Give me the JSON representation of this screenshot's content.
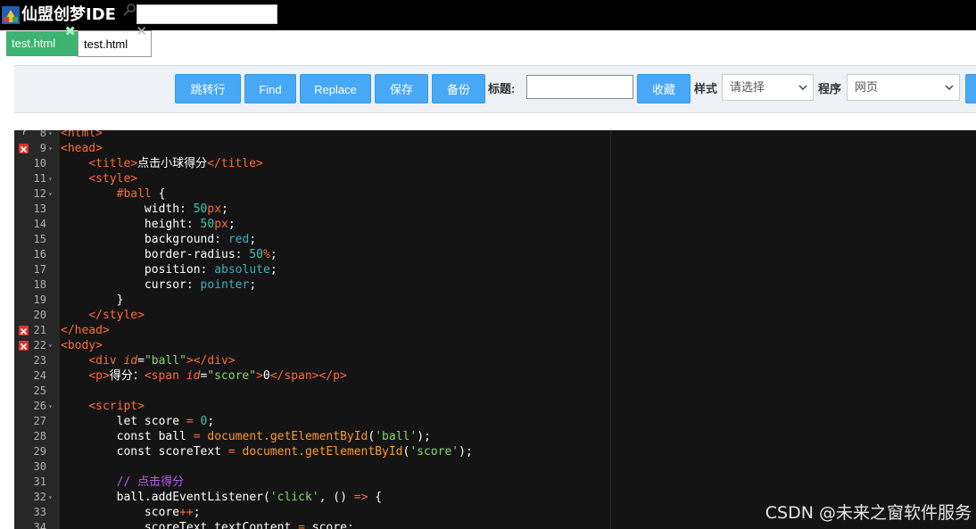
{
  "app": {
    "title": "仙盟创梦IDE",
    "search_value": ""
  },
  "tabs": [
    {
      "label": "test.html",
      "active": true,
      "close": "✖"
    },
    {
      "label": "test.html",
      "active": false,
      "close": "✕"
    }
  ],
  "toolbar": {
    "goto_label": "跳转行",
    "find_label": "Find",
    "replace_label": "Replace",
    "save_label": "保存",
    "backup_label": "备份",
    "title_label": "标题:",
    "title_value": "",
    "favorite_label": "收藏",
    "style_label": "样式",
    "style_selected": "请选择",
    "program_label": "程序",
    "program_selected": "网页"
  },
  "editor": {
    "lines": [
      {
        "n": "8",
        "marker": "warn",
        "fold": true,
        "tokens": [
          [
            "t-tag",
            "<html>"
          ]
        ]
      },
      {
        "n": "9",
        "marker": "error",
        "fold": true,
        "tokens": [
          [
            "t-tag",
            "<head>"
          ]
        ]
      },
      {
        "n": "10",
        "tokens": [
          [
            "t-plain",
            "    "
          ],
          [
            "t-tag",
            "<title>"
          ],
          [
            "t-plain",
            "点击小球得分"
          ],
          [
            "t-tag",
            "</title>"
          ]
        ]
      },
      {
        "n": "11",
        "fold": true,
        "tokens": [
          [
            "t-plain",
            "    "
          ],
          [
            "t-tag",
            "<style>"
          ]
        ]
      },
      {
        "n": "12",
        "fold": true,
        "tokens": [
          [
            "t-plain",
            "        "
          ],
          [
            "t-tag",
            "#ball"
          ],
          [
            "t-plain",
            " {"
          ]
        ]
      },
      {
        "n": "13",
        "tokens": [
          [
            "t-plain",
            "            width: "
          ],
          [
            "t-num",
            "50"
          ],
          [
            "t-unit",
            "px"
          ],
          [
            "t-plain",
            ";"
          ]
        ]
      },
      {
        "n": "14",
        "tokens": [
          [
            "t-plain",
            "            height: "
          ],
          [
            "t-num",
            "50"
          ],
          [
            "t-unit",
            "px"
          ],
          [
            "t-plain",
            ";"
          ]
        ]
      },
      {
        "n": "15",
        "tokens": [
          [
            "t-plain",
            "            background: "
          ],
          [
            "t-val",
            "red"
          ],
          [
            "t-plain",
            ";"
          ]
        ]
      },
      {
        "n": "16",
        "tokens": [
          [
            "t-plain",
            "            border-radius: "
          ],
          [
            "t-num",
            "50"
          ],
          [
            "t-unit",
            "%"
          ],
          [
            "t-plain",
            ";"
          ]
        ]
      },
      {
        "n": "17",
        "tokens": [
          [
            "t-plain",
            "            position: "
          ],
          [
            "t-val",
            "absolute"
          ],
          [
            "t-plain",
            ";"
          ]
        ]
      },
      {
        "n": "18",
        "tokens": [
          [
            "t-plain",
            "            cursor: "
          ],
          [
            "t-val",
            "pointer"
          ],
          [
            "t-plain",
            ";"
          ]
        ]
      },
      {
        "n": "19",
        "tokens": [
          [
            "t-plain",
            "        }"
          ]
        ]
      },
      {
        "n": "20",
        "tokens": [
          [
            "t-plain",
            "    "
          ],
          [
            "t-tag",
            "</style>"
          ]
        ]
      },
      {
        "n": "21",
        "marker": "error",
        "tokens": [
          [
            "t-tag",
            "</head>"
          ]
        ]
      },
      {
        "n": "22",
        "marker": "error",
        "fold": true,
        "tokens": [
          [
            "t-tag",
            "<body>"
          ]
        ]
      },
      {
        "n": "23",
        "tokens": [
          [
            "t-plain",
            "    "
          ],
          [
            "t-tag",
            "<div "
          ],
          [
            "t-attr",
            "id"
          ],
          [
            "t-plain",
            "="
          ],
          [
            "t-str",
            "\"ball\""
          ],
          [
            "t-tag",
            "></div>"
          ]
        ]
      },
      {
        "n": "24",
        "tokens": [
          [
            "t-plain",
            "    "
          ],
          [
            "t-tag",
            "<p>"
          ],
          [
            "t-plain",
            "得分："
          ],
          [
            "t-tag",
            "<span "
          ],
          [
            "t-attr",
            "id"
          ],
          [
            "t-plain",
            "="
          ],
          [
            "t-str",
            "\"score\""
          ],
          [
            "t-tag",
            ">"
          ],
          [
            "t-plain",
            "0"
          ],
          [
            "t-tag",
            "</span></p>"
          ]
        ]
      },
      {
        "n": "25",
        "tokens": []
      },
      {
        "n": "26",
        "fold": true,
        "tokens": [
          [
            "t-plain",
            "    "
          ],
          [
            "t-tag",
            "<script>"
          ]
        ]
      },
      {
        "n": "27",
        "tokens": [
          [
            "t-plain",
            "        let score "
          ],
          [
            "t-op",
            "="
          ],
          [
            "t-plain",
            " "
          ],
          [
            "t-num",
            "0"
          ],
          [
            "t-plain",
            ";"
          ]
        ]
      },
      {
        "n": "28",
        "tokens": [
          [
            "t-plain",
            "        const ball "
          ],
          [
            "t-op",
            "="
          ],
          [
            "t-plain",
            " "
          ],
          [
            "t-fn",
            "document.getElementById"
          ],
          [
            "t-plain",
            "("
          ],
          [
            "t-str",
            "'ball'"
          ],
          [
            "t-plain",
            ");"
          ]
        ]
      },
      {
        "n": "29",
        "tokens": [
          [
            "t-plain",
            "        const scoreText "
          ],
          [
            "t-op",
            "="
          ],
          [
            "t-plain",
            " "
          ],
          [
            "t-fn",
            "document.getElementById"
          ],
          [
            "t-plain",
            "("
          ],
          [
            "t-str",
            "'score'"
          ],
          [
            "t-plain",
            ");"
          ]
        ]
      },
      {
        "n": "30",
        "tokens": []
      },
      {
        "n": "31",
        "tokens": [
          [
            "t-plain",
            "        "
          ],
          [
            "t-com",
            "// 点击得分"
          ]
        ]
      },
      {
        "n": "32",
        "fold": true,
        "tokens": [
          [
            "t-plain",
            "        ball.addEventListener("
          ],
          [
            "t-str",
            "'click'"
          ],
          [
            "t-plain",
            ", () "
          ],
          [
            "t-op",
            "=>"
          ],
          [
            "t-plain",
            " {"
          ]
        ]
      },
      {
        "n": "33",
        "tokens": [
          [
            "t-plain",
            "            score"
          ],
          [
            "t-op",
            "++"
          ],
          [
            "t-plain",
            ";"
          ]
        ]
      },
      {
        "n": "34",
        "tokens": [
          [
            "t-plain",
            "            scoreText.textContent "
          ],
          [
            "t-op",
            "="
          ],
          [
            "t-plain",
            " score;"
          ]
        ]
      }
    ]
  },
  "watermark": "CSDN @未来之窗软件服务"
}
